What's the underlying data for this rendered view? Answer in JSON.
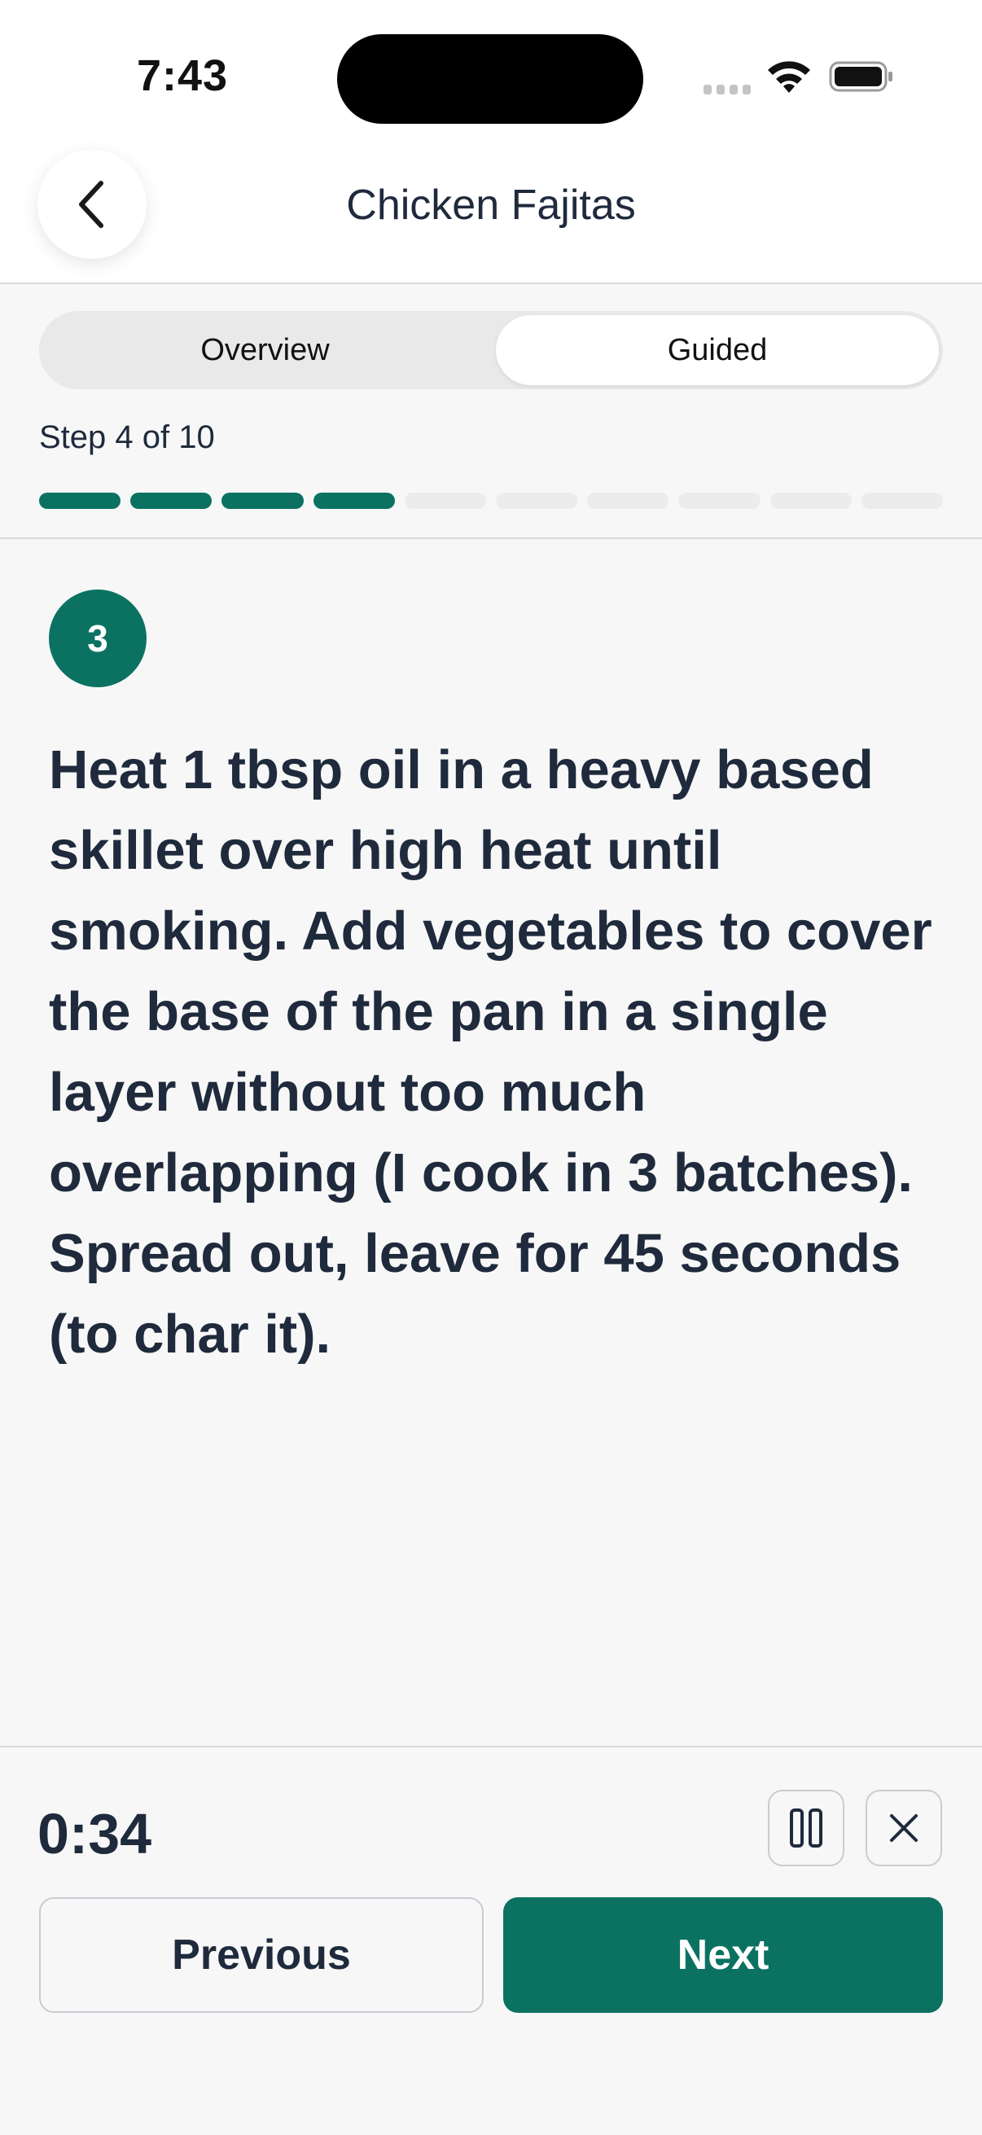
{
  "status_bar": {
    "time": "7:43"
  },
  "header": {
    "title": "Chicken Fajitas",
    "back_icon": "chevron-left-icon"
  },
  "tabs": [
    {
      "label": "Overview",
      "selected": false
    },
    {
      "label": "Guided",
      "selected": true
    }
  ],
  "progress": {
    "label": "Step 4 of 10",
    "current": 4,
    "total": 10
  },
  "step": {
    "number": "3",
    "text": "Heat 1 tbsp oil in a heavy based skillet over high heat until smoking. Add vegetables to cover the base of the pan in a single layer without too much overlapping (I cook in 3 batches). Spread out, leave for 45 seconds (to char it)."
  },
  "timer": {
    "value": "0:34",
    "pause_icon": "pause-icon",
    "close_icon": "close-icon"
  },
  "nav": {
    "previous_label": "Previous",
    "next_label": "Next"
  },
  "colors": {
    "accent": "#0b7262",
    "progress_inactive": "#ececec",
    "text": "#1f2a3c"
  }
}
